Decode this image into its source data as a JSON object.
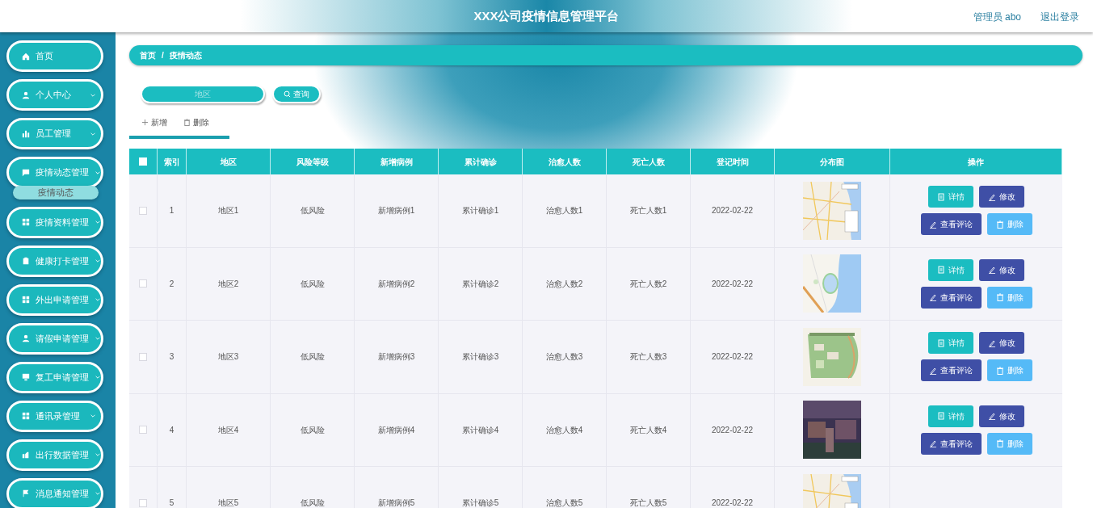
{
  "header": {
    "title": "XXX公司疫情信息管理平台",
    "user": "管理员 abo",
    "logout": "退出登录"
  },
  "sidebar": {
    "items": [
      {
        "label": "首页",
        "kind": "link"
      },
      {
        "label": "个人中心",
        "kind": "menu",
        "expanded": false
      },
      {
        "label": "员工管理",
        "kind": "menu",
        "expanded": false
      },
      {
        "label": "疫情动态管理",
        "kind": "menu",
        "expanded": true,
        "children": [
          {
            "label": "疫情动态",
            "selected": true
          }
        ]
      },
      {
        "label": "疫情资料管理",
        "kind": "menu",
        "expanded": false
      },
      {
        "label": "健康打卡管理",
        "kind": "menu",
        "expanded": false
      },
      {
        "label": "外出申请管理",
        "kind": "menu",
        "expanded": false
      },
      {
        "label": "请假申请管理",
        "kind": "menu",
        "expanded": false
      },
      {
        "label": "复工申请管理",
        "kind": "menu",
        "expanded": false
      },
      {
        "label": "通讯录管理",
        "kind": "menu",
        "expanded": false
      },
      {
        "label": "出行数据管理",
        "kind": "menu",
        "expanded": false
      },
      {
        "label": "消息通知管理",
        "kind": "menu",
        "expanded": false
      }
    ]
  },
  "breadcrumb": {
    "items": [
      "首页",
      "疫情动态"
    ],
    "separator": "/"
  },
  "search": {
    "placeholder": "地区",
    "button": "查询"
  },
  "toolbar": [
    "新增",
    "删除"
  ],
  "table": {
    "select_all": {
      "checked": false
    },
    "columns": [
      "索引",
      "地区",
      "风险等级",
      "新增病例",
      "累计确诊",
      "治愈人数",
      "死亡人数",
      "登记时间",
      "分布图",
      "操作"
    ],
    "rows": [
      {
        "checked": false,
        "cells": [
          "1",
          "地区1",
          "低风险",
          "新增病例1",
          "累计确诊1",
          "治愈人数1",
          "死亡人数1",
          "2022-02-22"
        ],
        "picture": {
          "kind": "picture"
        },
        "actions": [
          "详情",
          "修改",
          "查看评论",
          "删除"
        ]
      },
      {
        "checked": false,
        "cells": [
          "2",
          "地区2",
          "低风险",
          "新增病例2",
          "累计确诊2",
          "治愈人数2",
          "死亡人数2",
          "2022-02-22"
        ],
        "picture": {
          "kind": "picture"
        },
        "actions": [
          "详情",
          "修改",
          "查看评论",
          "删除"
        ]
      },
      {
        "checked": false,
        "cells": [
          "3",
          "地区3",
          "低风险",
          "新增病例3",
          "累计确诊3",
          "治愈人数3",
          "死亡人数3",
          "2022-02-22"
        ],
        "picture": {
          "kind": "picture"
        },
        "actions": [
          "详情",
          "修改",
          "查看评论",
          "删除"
        ]
      },
      {
        "checked": false,
        "cells": [
          "4",
          "地区4",
          "低风险",
          "新增病例4",
          "累计确诊4",
          "治愈人数4",
          "死亡人数4",
          "2022-02-22"
        ],
        "picture": {
          "kind": "picture"
        },
        "actions": [
          "详情",
          "修改",
          "查看评论",
          "删除"
        ]
      },
      {
        "checked": false,
        "cells": [
          "5",
          "地区5",
          "低风险",
          "新增病例5",
          "累计确诊5",
          "治愈人数5",
          "死亡人数5",
          "2022-02-22"
        ],
        "picture": {
          "kind": "picture"
        }
      }
    ]
  }
}
